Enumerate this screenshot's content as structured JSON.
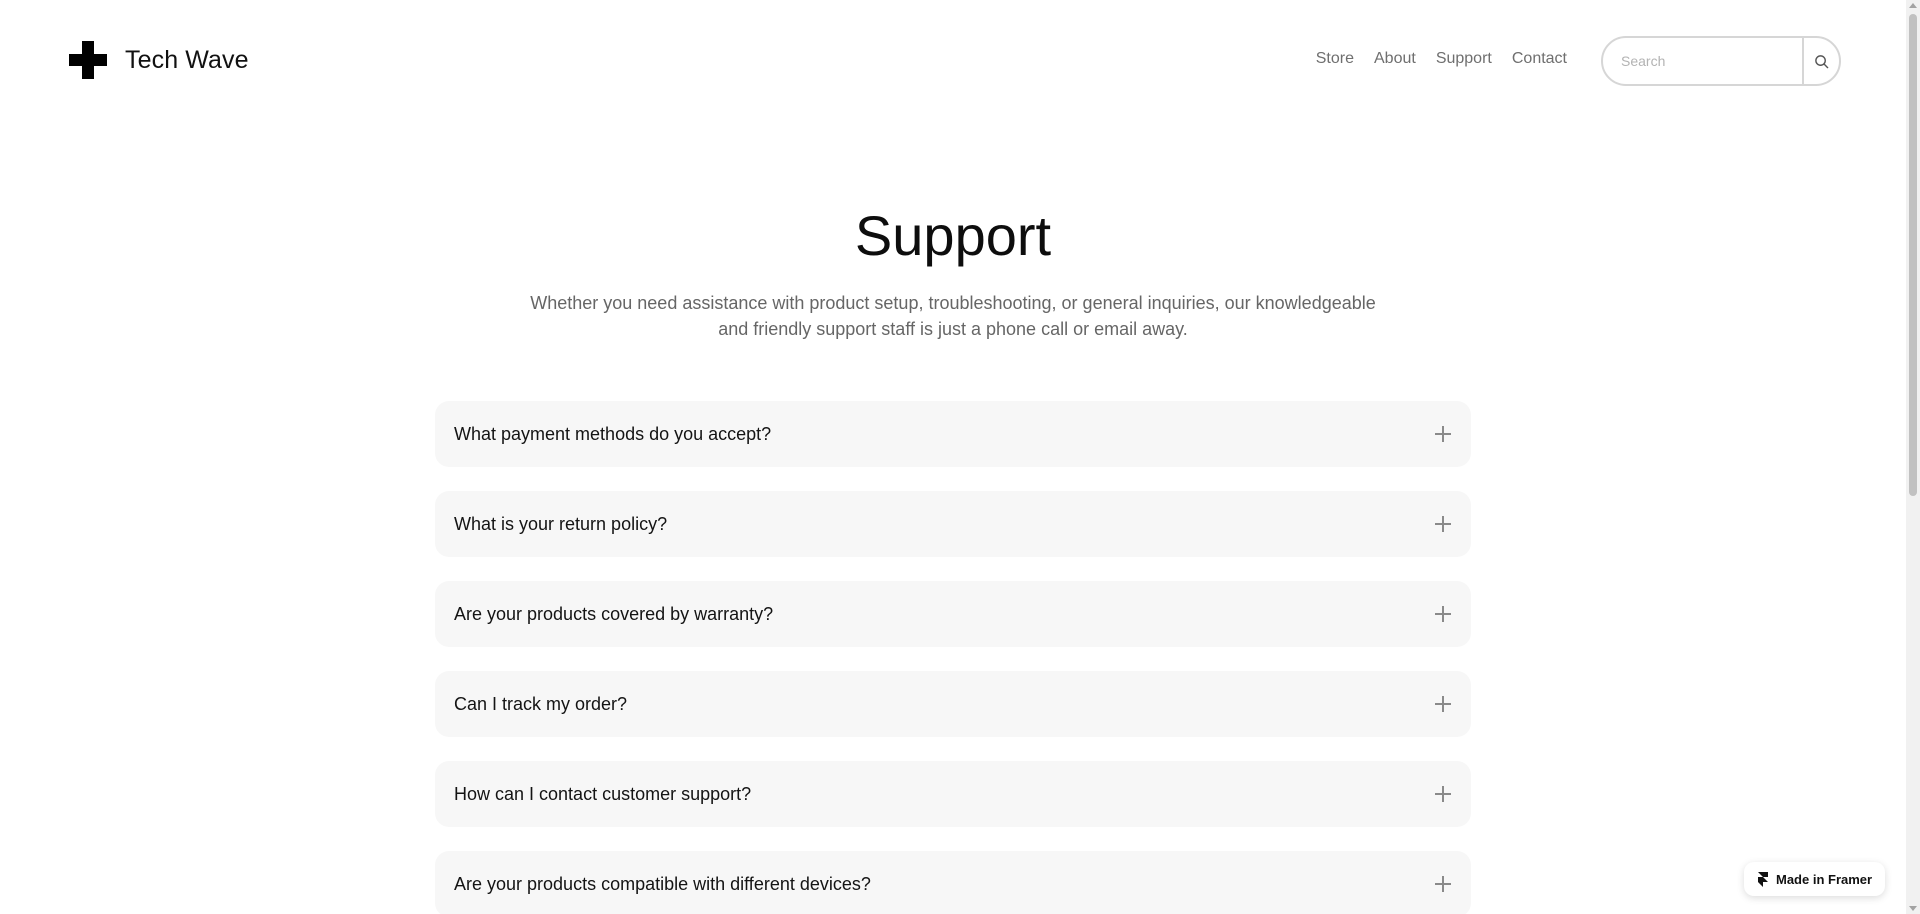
{
  "brand": {
    "name": "Tech Wave",
    "logo_icon": "plus-cross-logo-icon"
  },
  "nav": {
    "items": [
      {
        "label": "Store"
      },
      {
        "label": "About"
      },
      {
        "label": "Support"
      },
      {
        "label": "Contact"
      }
    ]
  },
  "search": {
    "placeholder": "Search",
    "value": "",
    "icon": "search-icon"
  },
  "hero": {
    "title": "Support",
    "subtitle": "Whether you need assistance with product setup, troubleshooting, or general inquiries, our knowledgeable and friendly support staff is just a phone call or email away."
  },
  "faq": {
    "items": [
      {
        "question": "What payment methods do you accept?"
      },
      {
        "question": "What is your return policy?"
      },
      {
        "question": "Are your products covered by warranty?"
      },
      {
        "question": "Can I track my order?"
      },
      {
        "question": "How can I contact customer support?"
      },
      {
        "question": "Are your products compatible with different devices?"
      }
    ],
    "expand_icon": "plus-icon"
  },
  "badge": {
    "label": "Made in Framer",
    "icon": "framer-icon"
  },
  "colors": {
    "background": "#ffffff",
    "text": "#111111",
    "muted": "#6f6f6f",
    "faq_bg": "#f7f7f7"
  }
}
